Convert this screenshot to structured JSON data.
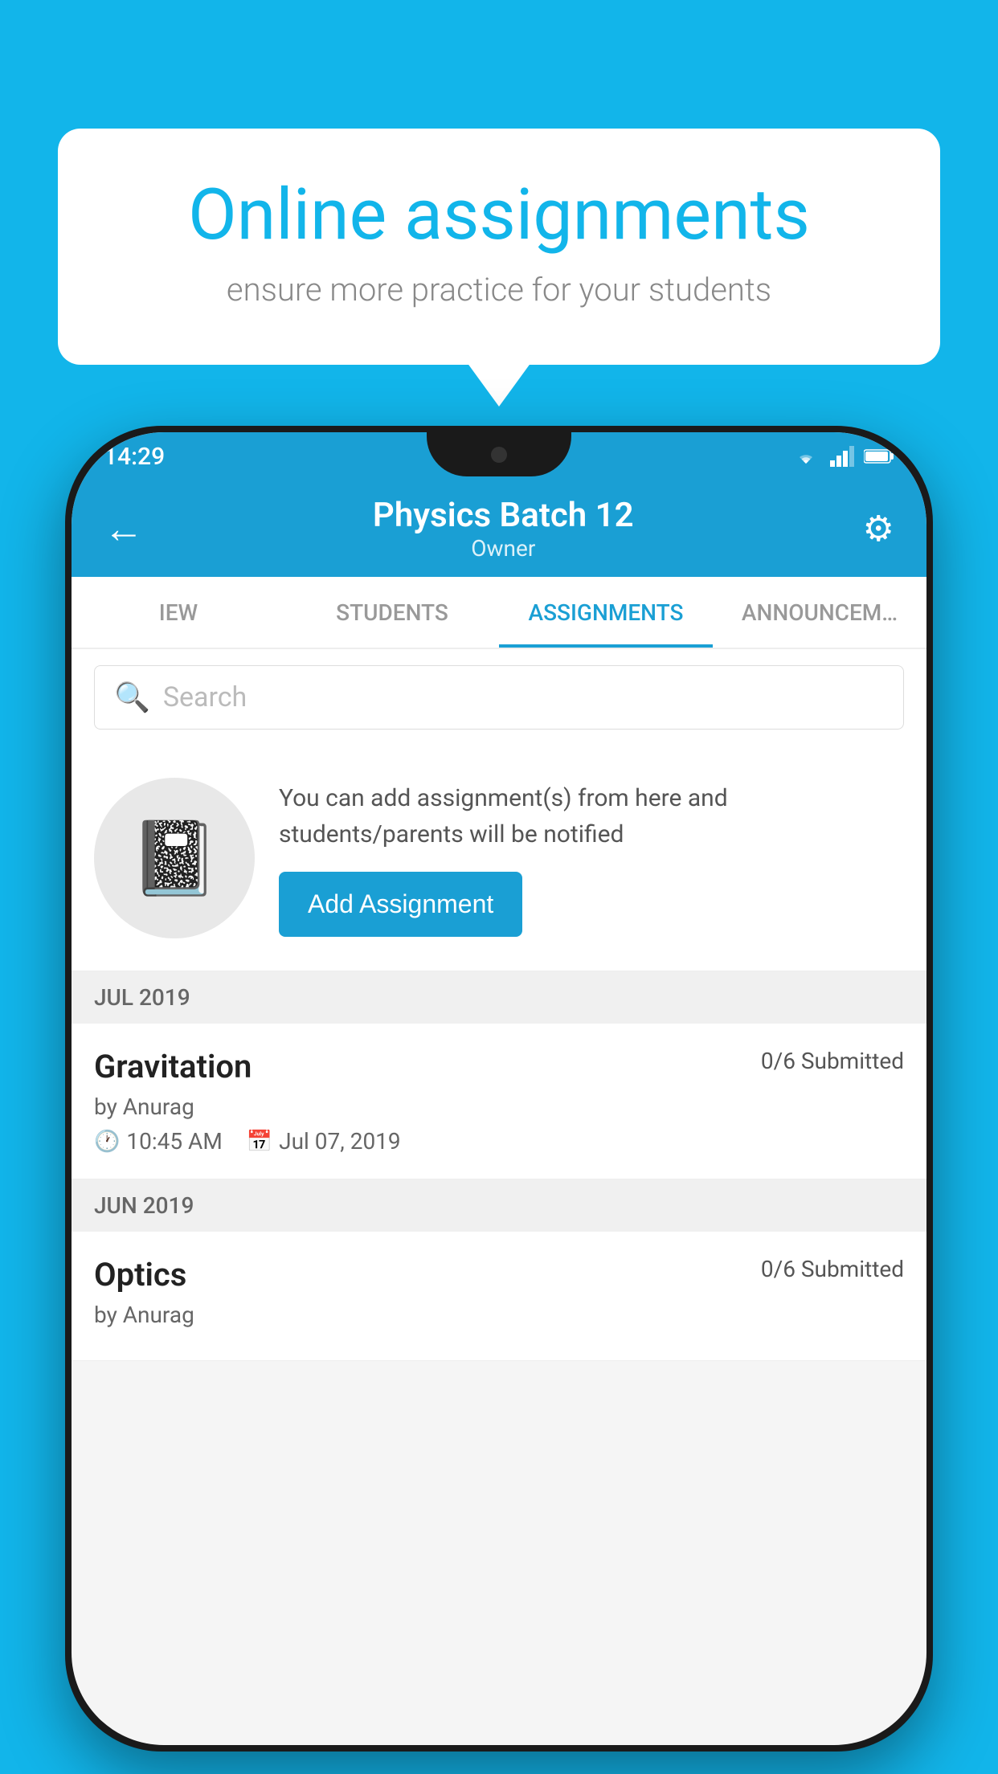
{
  "background": {
    "color": "#12B5EA"
  },
  "speechBubble": {
    "title": "Online assignments",
    "subtitle": "ensure more practice for your students"
  },
  "statusBar": {
    "time": "14:29",
    "icons": [
      "wifi",
      "signal",
      "battery"
    ]
  },
  "appBar": {
    "title": "Physics Batch 12",
    "subtitle": "Owner",
    "backLabel": "←",
    "settingsLabel": "⚙"
  },
  "tabs": [
    {
      "label": "IEW",
      "active": false
    },
    {
      "label": "STUDENTS",
      "active": false
    },
    {
      "label": "ASSIGNMENTS",
      "active": true
    },
    {
      "label": "ANNOUNCEM…",
      "active": false
    }
  ],
  "search": {
    "placeholder": "Search"
  },
  "emptyState": {
    "description": "You can add assignment(s) from here and students/parents will be notified",
    "buttonLabel": "Add Assignment"
  },
  "sections": [
    {
      "month": "JUL 2019",
      "assignments": [
        {
          "name": "Gravitation",
          "submitted": "0/6 Submitted",
          "by": "by Anurag",
          "time": "10:45 AM",
          "date": "Jul 07, 2019"
        }
      ]
    },
    {
      "month": "JUN 2019",
      "assignments": [
        {
          "name": "Optics",
          "submitted": "0/6 Submitted",
          "by": "by Anurag",
          "time": "",
          "date": ""
        }
      ]
    }
  ]
}
